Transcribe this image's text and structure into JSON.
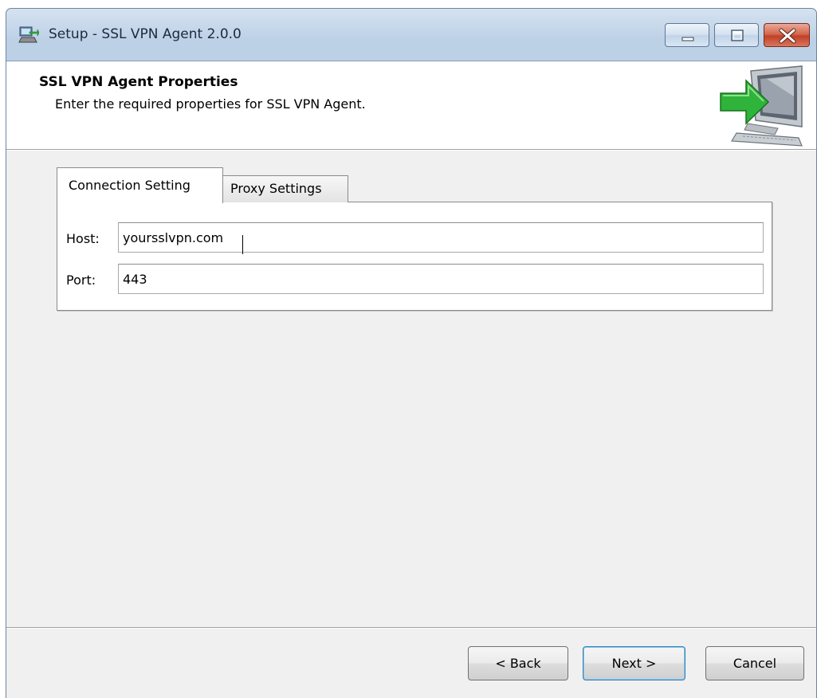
{
  "window": {
    "title": "Setup - SSL VPN Agent 2.0.0",
    "icon": "setup-installer-icon"
  },
  "caption_buttons": {
    "minimize": "minimize-icon",
    "maximize": "maximize-icon",
    "close": "close-icon"
  },
  "header": {
    "title": "SSL VPN Agent Properties",
    "subtitle": "Enter the required properties for SSL VPN Agent.",
    "image": "computer-install-arrow-icon"
  },
  "tabs": [
    {
      "label": "Connection Setting",
      "active": true
    },
    {
      "label": "Proxy Settings",
      "active": false
    }
  ],
  "form": {
    "host": {
      "label": "Host:",
      "value": "yoursslvpn.com"
    },
    "port": {
      "label": "Port:",
      "value": "443"
    }
  },
  "buttons": {
    "back": "< Back",
    "next": "Next >",
    "cancel": "Cancel"
  },
  "colors": {
    "titlebar": "#bcd0e6",
    "client": "#f0f0f0",
    "close_button": "#c0412a",
    "arrow": "#2fb33a"
  }
}
